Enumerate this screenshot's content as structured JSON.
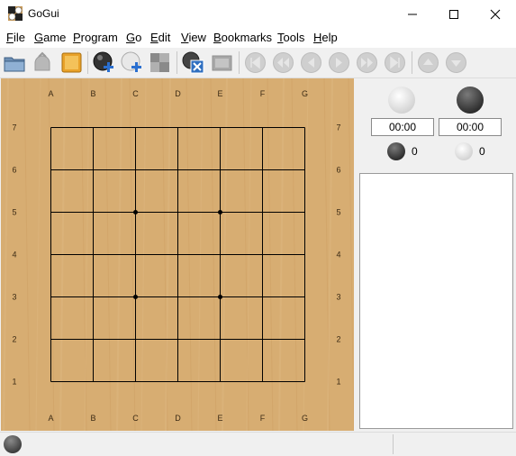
{
  "window": {
    "title": "GoGui"
  },
  "menu": [
    {
      "label": "File",
      "u": "F",
      "rest": "ile"
    },
    {
      "label": "Game",
      "u": "G",
      "rest": "ame"
    },
    {
      "label": "Program",
      "u": "P",
      "rest": "rogram"
    },
    {
      "label": "Go",
      "u": "G",
      "rest": "o"
    },
    {
      "label": "Edit",
      "u": "E",
      "rest": "dit"
    },
    {
      "label": "View",
      "u": "V",
      "rest": "iew"
    },
    {
      "label": "Bookmarks",
      "u": "B",
      "rest": "ookmarks"
    },
    {
      "label": "Tools",
      "u": "T",
      "rest": "ools"
    },
    {
      "label": "Help",
      "u": "H",
      "rest": "elp"
    }
  ],
  "toolbar": {
    "buttons": [
      {
        "name": "open-icon",
        "enabled": true
      },
      {
        "name": "save-icon",
        "enabled": false
      },
      {
        "name": "new-game-icon",
        "enabled": true
      },
      {
        "name": "setup-black-icon",
        "enabled": true
      },
      {
        "name": "setup-white-icon",
        "enabled": true
      },
      {
        "name": "setup-board-icon",
        "enabled": false
      },
      {
        "name": "detach-program-icon",
        "enabled": true
      },
      {
        "name": "gtp-shell-icon",
        "enabled": false
      },
      {
        "name": "beginning-icon",
        "enabled": false
      },
      {
        "name": "backward-ten-icon",
        "enabled": false
      },
      {
        "name": "backward-icon",
        "enabled": false
      },
      {
        "name": "forward-icon",
        "enabled": false
      },
      {
        "name": "forward-ten-icon",
        "enabled": false
      },
      {
        "name": "end-icon",
        "enabled": false
      },
      {
        "name": "previous-variation-icon",
        "enabled": false
      },
      {
        "name": "next-variation-icon",
        "enabled": false
      }
    ]
  },
  "board": {
    "size": 7,
    "columns": [
      "A",
      "B",
      "C",
      "D",
      "E",
      "F",
      "G"
    ],
    "rows": [
      "7",
      "6",
      "5",
      "4",
      "3",
      "2",
      "1"
    ],
    "hoshi": [
      "C5",
      "E5",
      "C3",
      "E3"
    ],
    "wood_color": "#d7ad72"
  },
  "side": {
    "white_clock": "00:00",
    "black_clock": "00:00",
    "black_captures": "0",
    "white_captures": "0"
  },
  "status": {
    "to_move": "black"
  }
}
